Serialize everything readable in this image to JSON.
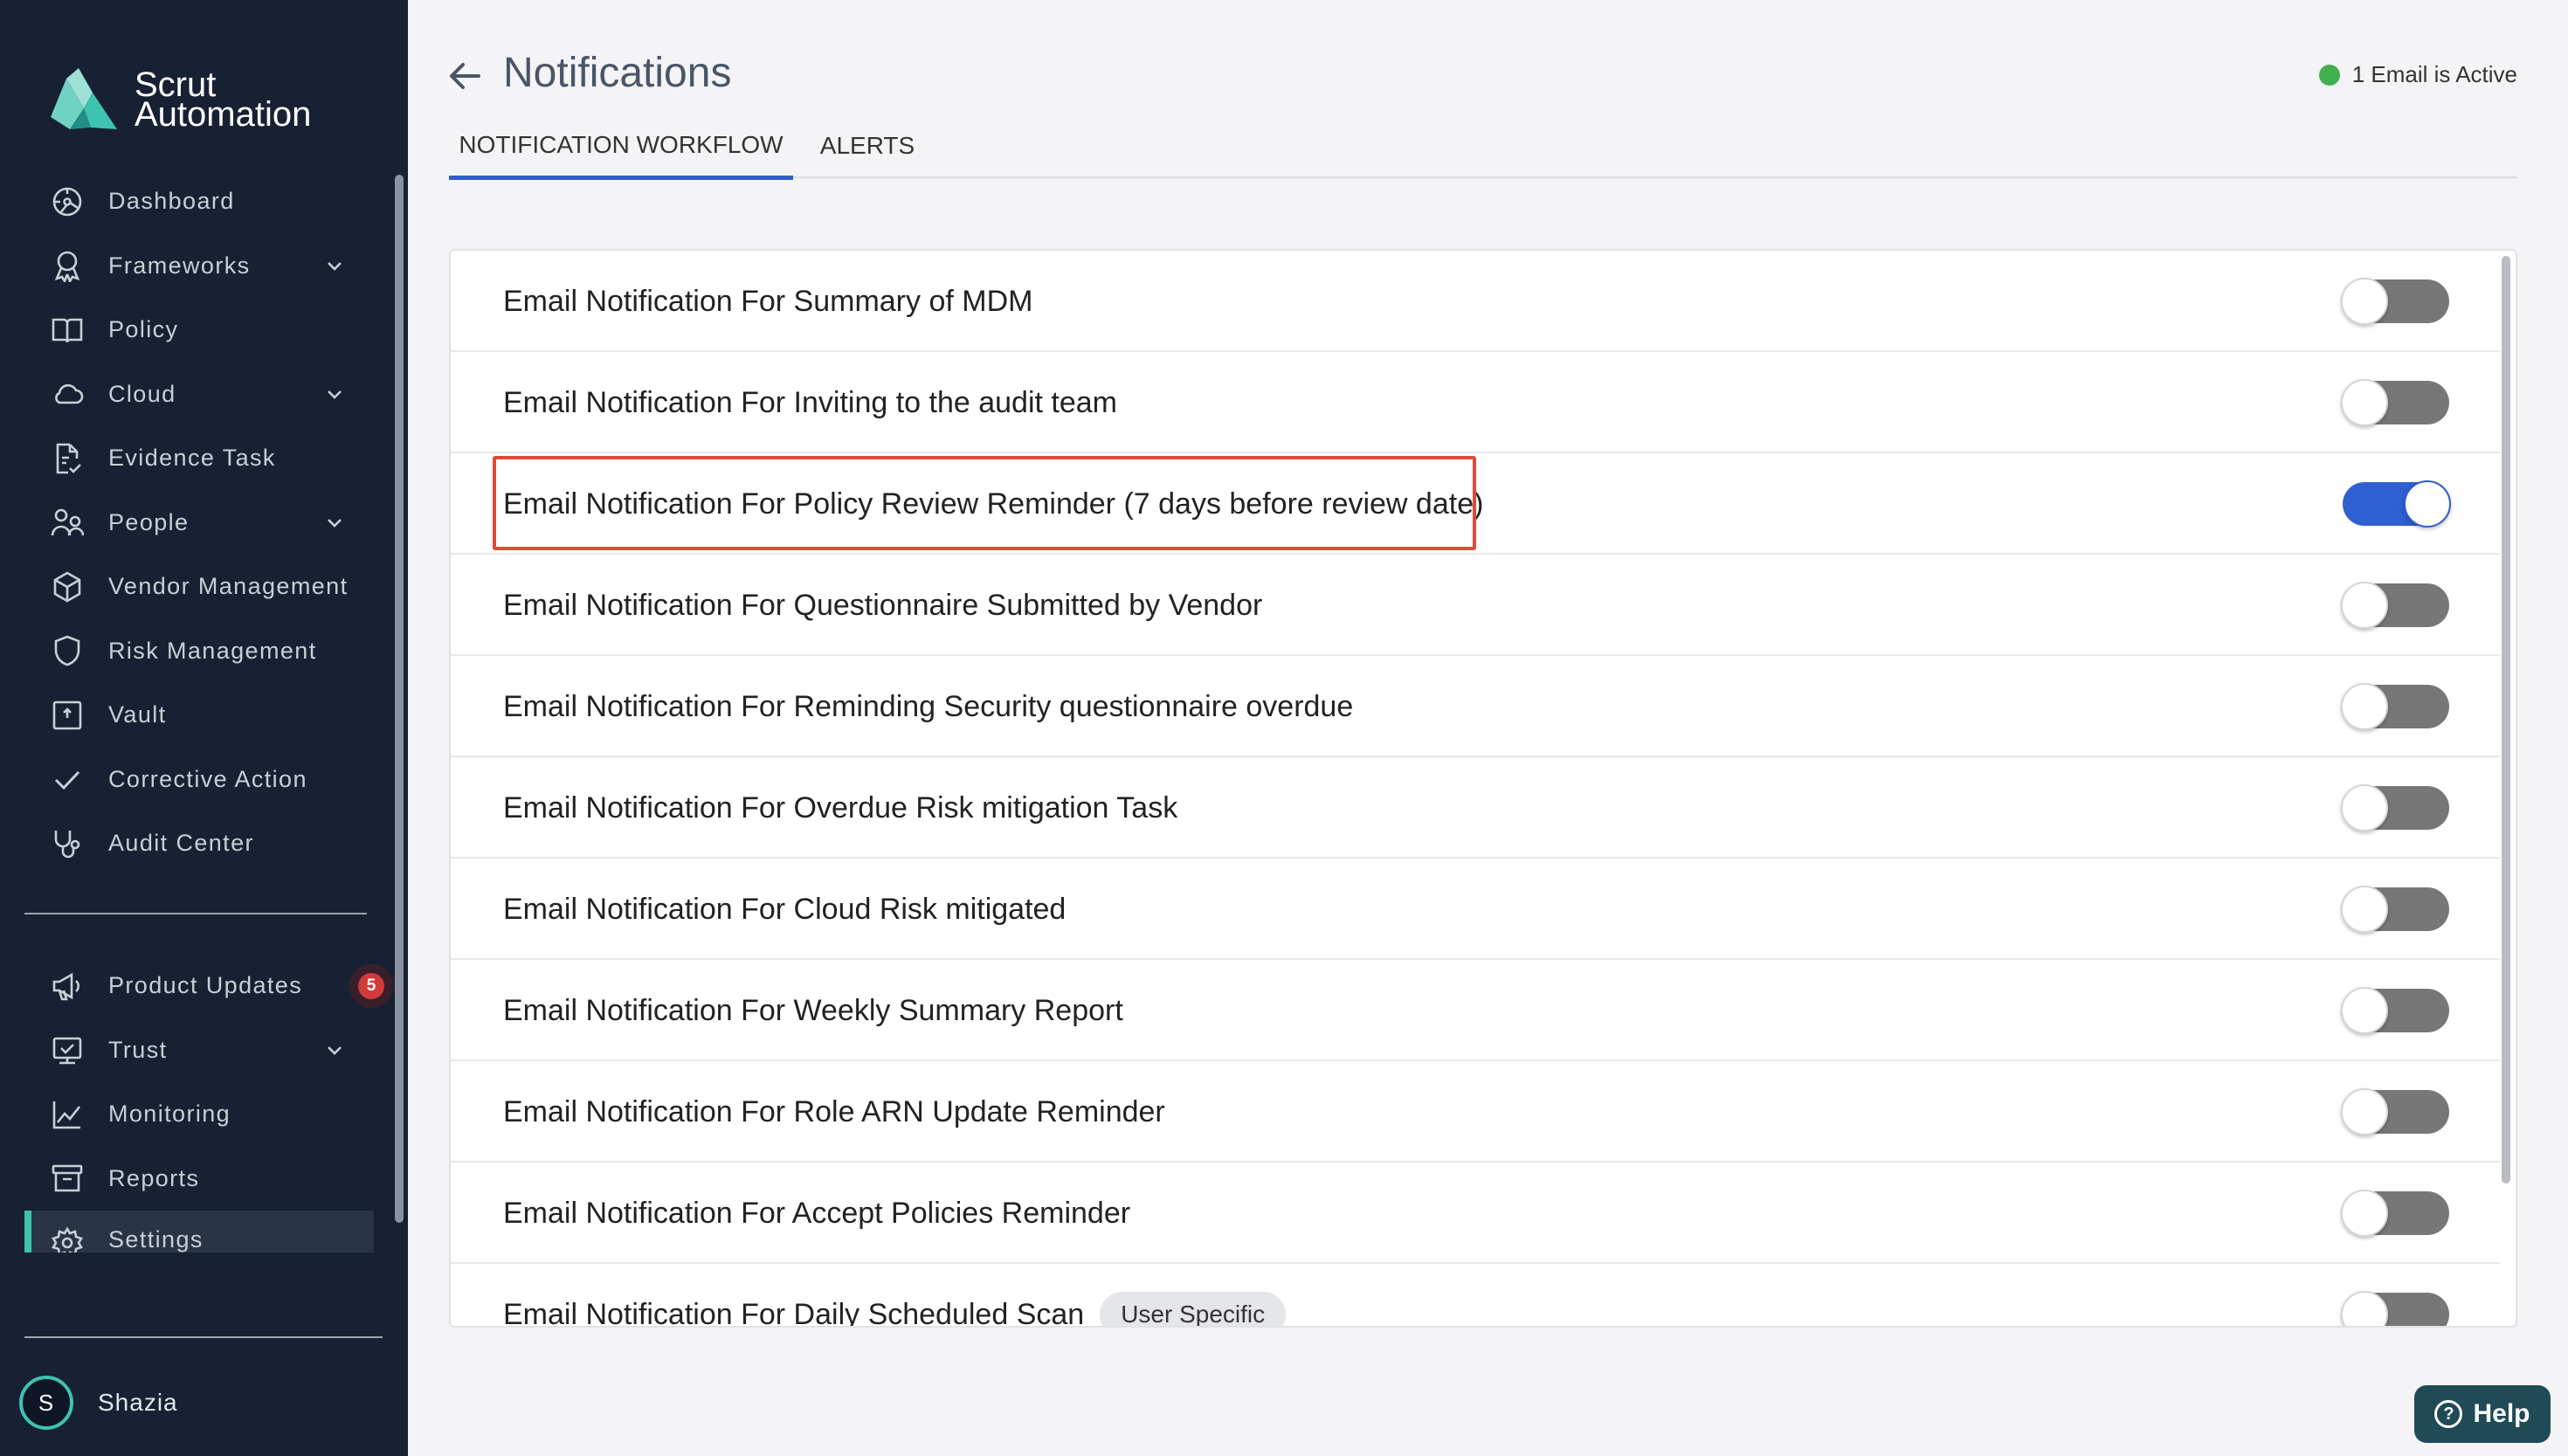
{
  "brand": {
    "line1": "Scrut",
    "line2": "Automation"
  },
  "sidebar": {
    "items": [
      {
        "label": "Dashboard",
        "icon": "dashboard-icon",
        "expandable": false
      },
      {
        "label": "Frameworks",
        "icon": "award-icon",
        "expandable": true
      },
      {
        "label": "Policy",
        "icon": "book-icon",
        "expandable": false
      },
      {
        "label": "Cloud",
        "icon": "cloud-icon",
        "expandable": true
      },
      {
        "label": "Evidence Task",
        "icon": "evidence-icon",
        "expandable": false
      },
      {
        "label": "People",
        "icon": "people-icon",
        "expandable": true
      },
      {
        "label": "Vendor Management",
        "icon": "cube-icon",
        "expandable": false
      },
      {
        "label": "Risk Management",
        "icon": "shield-icon",
        "expandable": false
      },
      {
        "label": "Vault",
        "icon": "vault-icon",
        "expandable": false
      },
      {
        "label": "Corrective Action",
        "icon": "check-icon",
        "expandable": false
      },
      {
        "label": "Audit Center",
        "icon": "stethoscope-icon",
        "expandable": false
      }
    ],
    "secondary": [
      {
        "label": "Product Updates",
        "icon": "megaphone-icon",
        "badge": "5"
      },
      {
        "label": "Trust",
        "icon": "trust-icon",
        "expandable": true
      },
      {
        "label": "Monitoring",
        "icon": "chart-line-icon"
      },
      {
        "label": "Reports",
        "icon": "archive-icon"
      },
      {
        "label": "Settings",
        "icon": "gear-icon",
        "active": true
      }
    ],
    "user": {
      "initial": "S",
      "name": "Shazia"
    }
  },
  "header": {
    "title": "Notifications",
    "status": "1 Email is Active",
    "status_color": "#3fb04d"
  },
  "tabs": [
    {
      "label": "NOTIFICATION WORKFLOW",
      "active": true
    },
    {
      "label": "ALERTS",
      "active": false
    }
  ],
  "notifications": [
    {
      "label": "Email Notification For Summary of MDM",
      "enabled": false
    },
    {
      "label": "Email Notification For Inviting to the audit team",
      "enabled": false
    },
    {
      "label": "Email Notification For Policy Review Reminder (7 days before review date)",
      "enabled": true,
      "highlighted": true
    },
    {
      "label": "Email Notification For Questionnaire Submitted by Vendor",
      "enabled": false
    },
    {
      "label": "Email Notification For Reminding Security questionnaire overdue",
      "enabled": false
    },
    {
      "label": "Email Notification For Overdue Risk mitigation Task",
      "enabled": false
    },
    {
      "label": "Email Notification For Cloud Risk mitigated",
      "enabled": false
    },
    {
      "label": "Email Notification For Weekly Summary Report",
      "enabled": false
    },
    {
      "label": "Email Notification For Role ARN Update Reminder",
      "enabled": false
    },
    {
      "label": "Email Notification For Accept Policies Reminder",
      "enabled": false
    },
    {
      "label": "Email Notification For Daily Scheduled Scan",
      "enabled": false,
      "chip": "User Specific"
    }
  ],
  "help": {
    "label": "Help"
  },
  "colors": {
    "sidebar_bg": "#172133",
    "accent_teal": "#3ec3b0",
    "toggle_on": "#2f5fd0",
    "toggle_off": "#777777",
    "highlight": "#e24a38"
  }
}
